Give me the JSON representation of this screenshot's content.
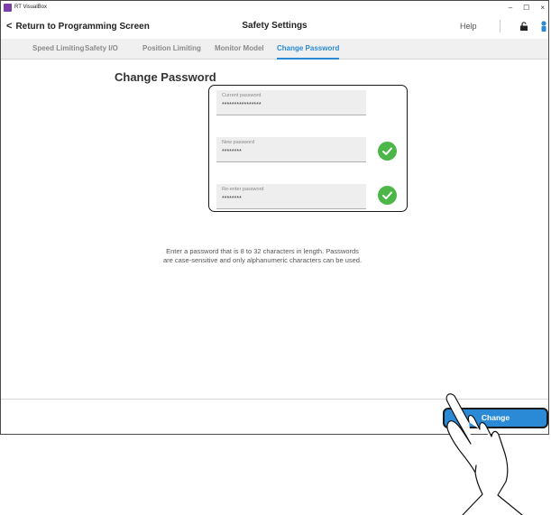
{
  "window": {
    "app_title": "RT VisualBox",
    "controls": {
      "minimize": "–",
      "maximize": "☐",
      "close": "×"
    }
  },
  "header": {
    "back_label": "Return to Programming Screen",
    "title": "Safety Settings",
    "help_label": "Help",
    "icons": [
      "lock-icon",
      "user-icon"
    ]
  },
  "tabs": [
    {
      "label": "Speed Limiting",
      "active": false
    },
    {
      "label": "Safety I/O",
      "active": false
    },
    {
      "label": "Position Limiting",
      "active": false
    },
    {
      "label": "Monitor Model",
      "active": false
    },
    {
      "label": "Change Password",
      "active": true
    }
  ],
  "main": {
    "section_title": "Change Password",
    "fields": [
      {
        "label": "Current password",
        "value": "****************",
        "valid": false
      },
      {
        "label": "New password",
        "value": "********",
        "valid": true
      },
      {
        "label": "Re-enter password",
        "value": "********",
        "valid": true
      }
    ],
    "info_line1": "Enter a password that is 8 to 32 characters in length. Passwords",
    "info_line2": "are case-sensitive and only alphanumeric characters can be used."
  },
  "footer": {
    "change_label": "Change"
  },
  "colors": {
    "accent": "#2b8ad6",
    "valid": "#4cb648",
    "tab_inactive": "#8a8a8a"
  }
}
